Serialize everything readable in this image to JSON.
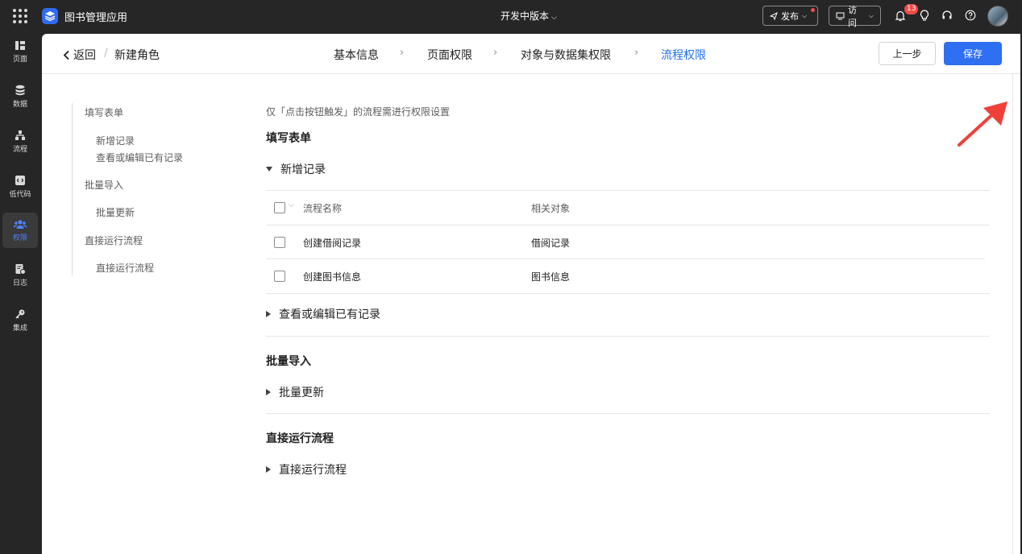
{
  "topbar": {
    "app_title": "图书管理应用",
    "version_label": "开发中版本",
    "publish_label": "发布",
    "visit_label": "访问",
    "notification_count": "13"
  },
  "sidebar": {
    "items": [
      {
        "label": "页面",
        "icon": "layout-icon"
      },
      {
        "label": "数据",
        "icon": "database-icon"
      },
      {
        "label": "流程",
        "icon": "flow-icon"
      },
      {
        "label": "低代码",
        "icon": "code-icon"
      },
      {
        "label": "权限",
        "icon": "users-icon",
        "active": true
      },
      {
        "label": "日志",
        "icon": "log-icon"
      },
      {
        "label": "集成",
        "icon": "key-icon"
      }
    ]
  },
  "header": {
    "back_label": "返回",
    "separator": "/",
    "title": "新建角色",
    "steps": [
      "基本信息",
      "页面权限",
      "对象与数据集权限",
      "流程权限"
    ],
    "active_step": 3,
    "prev_label": "上一步",
    "save_label": "保存"
  },
  "outline": {
    "items": [
      "填写表单",
      "新增记录",
      "查看或编辑已有记录",
      "批量导入",
      "批量更新",
      "直接运行流程",
      "直接运行流程"
    ]
  },
  "content": {
    "hint": "仅「点击按钮触发」的流程需进行权限设置",
    "sections": [
      {
        "title": "填写表单"
      },
      {
        "title": "批量导入"
      },
      {
        "title": "直接运行流程"
      }
    ],
    "groups": [
      "新增记录",
      "查看或编辑已有记录",
      "批量更新",
      "直接运行流程"
    ],
    "table": {
      "headers": [
        "流程名称",
        "相关对象"
      ],
      "rows": [
        {
          "name": "创建借阅记录",
          "object": "借阅记录"
        },
        {
          "name": "创建图书信息",
          "object": "图书信息"
        }
      ]
    }
  },
  "colors": {
    "accent": "#2f6ff2",
    "annotation": "#f0403a",
    "sidebar_bg": "#262626"
  }
}
